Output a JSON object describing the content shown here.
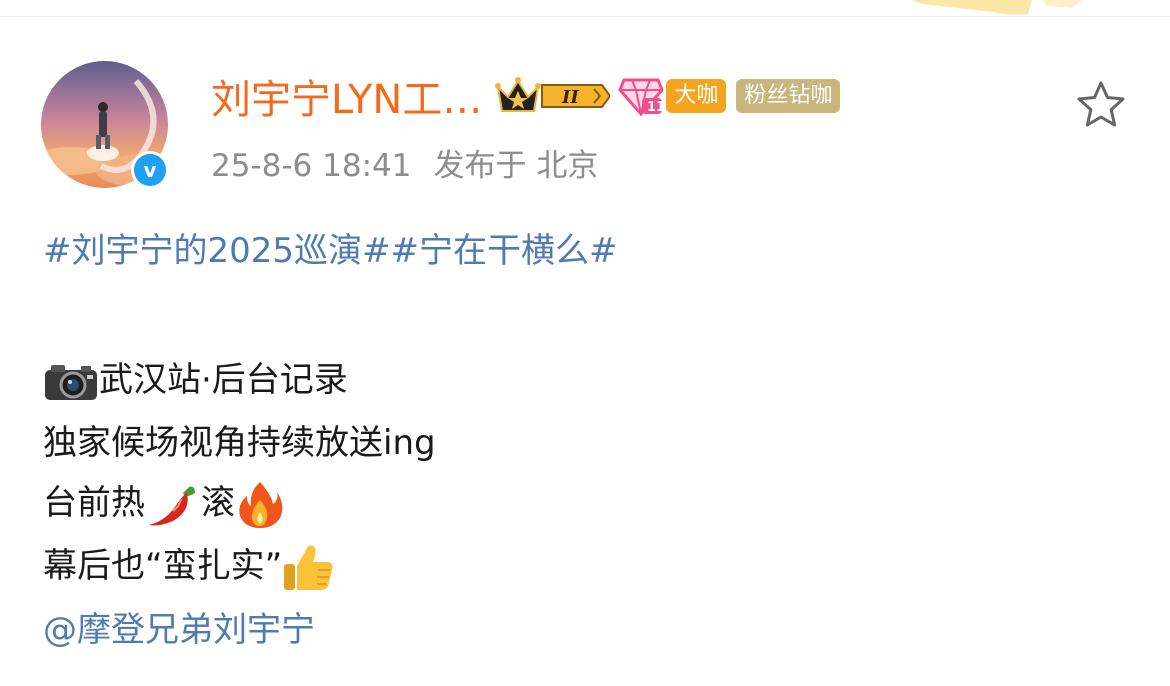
{
  "post": {
    "author": {
      "name": "刘宇宁LYN工…",
      "badge_daka": "大咖",
      "badge_fans": "粉丝钻咖"
    },
    "meta": {
      "time": "25-8-6 18:41",
      "location": "发布于 北京"
    },
    "topics": [
      "#刘宇宁的2025巡演#",
      "#宁在干横么#"
    ],
    "lines": {
      "line1": "武汉站·后台记录",
      "line2": "独家候场视角持续放送ing",
      "line3_a": "台前热",
      "line3_b": "滚",
      "line4": "幕后也“蛮扎实”"
    },
    "mention": "@摩登兄弟刘宇宁"
  },
  "colors": {
    "username": "#f26b1d",
    "link": "#4f7bb0",
    "meta": "#8d8d8d",
    "tag_daka": "#f5a41e",
    "tag_fans": "#c9b67c",
    "verified": "#1da1f2"
  },
  "icons": {
    "verified": "verified-v-icon",
    "crown": "crown-level-badge-icon",
    "diamond": "diamond-member-icon",
    "favorite": "star-outline-icon",
    "camera": "camera-emoji",
    "pepper": "hot-pepper-emoji",
    "fire": "fire-emoji",
    "thumbs": "thumbs-up-emoji"
  }
}
